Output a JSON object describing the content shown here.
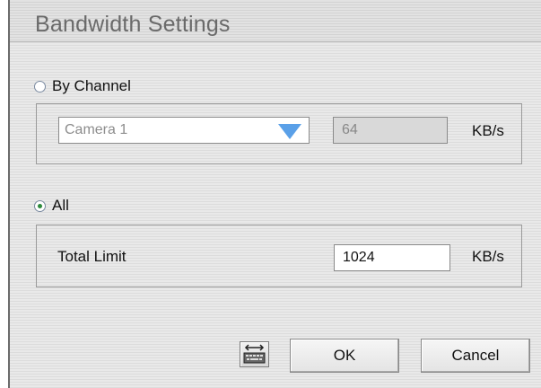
{
  "dialog": {
    "title": "Bandwidth Settings"
  },
  "by_channel": {
    "label": "By Channel",
    "selected": false,
    "camera_select_value": "Camera 1",
    "bandwidth_value": "64",
    "unit": "KB/s"
  },
  "all": {
    "label": "All",
    "selected": true,
    "total_limit_label": "Total Limit",
    "total_limit_value": "1024",
    "unit": "KB/s"
  },
  "buttons": {
    "keyboard_icon": "keyboard-icon",
    "ok": "OK",
    "cancel": "Cancel"
  },
  "colors": {
    "dropdown_arrow": "#5aa0e8",
    "radio_selected": "#2c8a3c"
  }
}
